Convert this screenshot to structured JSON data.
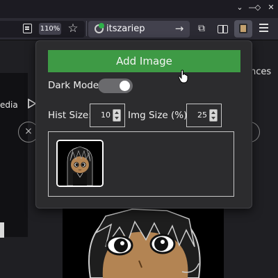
{
  "browser": {
    "zoom_level": "110%",
    "tab_title": "itszariep",
    "window_controls": [
      "chevron-down-icon",
      "minimize-icon",
      "restore-icon",
      "close-icon"
    ]
  },
  "page_behind": {
    "text_left": "edia",
    "text_right": "nces",
    "circle_icon": "×"
  },
  "popup": {
    "add_button_label": "Add Image",
    "dark_mode_label": "Dark Mode:",
    "dark_mode_on": true,
    "hist_size_label": "Hist Size:",
    "hist_size_value": "10",
    "img_size_label": "Img Size (%):",
    "img_size_value": "25"
  },
  "colors": {
    "accent_green": "#3e9a45",
    "popup_bg": "#2c2c2e",
    "toolbar_bg": "#2b2a33"
  }
}
